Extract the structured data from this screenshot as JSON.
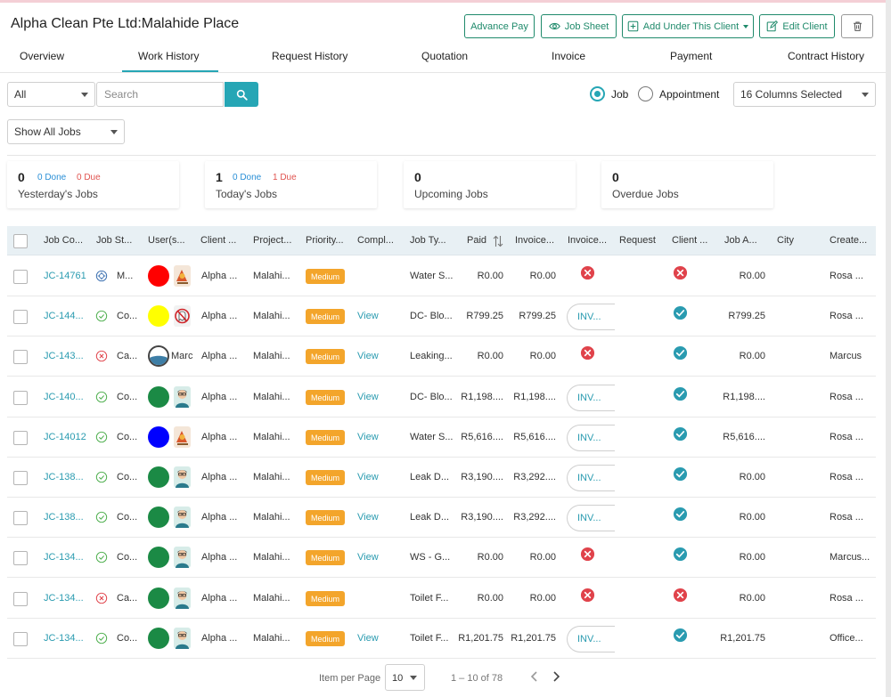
{
  "header": {
    "title": "Alpha Clean Pte Ltd:Malahide Place",
    "buttons": {
      "advance_pay": "Advance Pay",
      "job_sheet": "Job Sheet",
      "add_under_client": "Add Under This Client",
      "edit_client": "Edit Client"
    }
  },
  "tabs": [
    "Overview",
    "Work History",
    "Request History",
    "Quotation",
    "Invoice",
    "Payment",
    "Contract History"
  ],
  "active_tab": "Work History",
  "filters": {
    "type_select": "All",
    "search_placeholder": "Search",
    "radio_job": "Job",
    "radio_appointment": "Appointment",
    "selected_radio": "Job",
    "columns_select": "16 Columns Selected",
    "show_jobs_select": "Show All Jobs"
  },
  "summary_cards": [
    {
      "count": "0",
      "done": "0 Done",
      "due": "0 Due",
      "label": "Yesterday's Jobs"
    },
    {
      "count": "1",
      "done": "0 Done",
      "due": "1 Due",
      "label": "Today's Jobs"
    },
    {
      "count": "0",
      "done": "",
      "due": "",
      "label": "Upcoming Jobs"
    },
    {
      "count": "0",
      "done": "",
      "due": "",
      "label": "Overdue Jobs"
    }
  ],
  "table": {
    "columns": [
      "Job Co...",
      "Job St...",
      "User(s...",
      "Client ...",
      "Project...",
      "Priority...",
      "Compl...",
      "Job Ty...",
      "Paid",
      "Invoice...",
      "Invoice...",
      "Request",
      "Client ...",
      "Job A...",
      "City",
      "Create..."
    ],
    "rows": [
      {
        "code": "JC-14761",
        "status": "M...",
        "status_icon": "gear-icon",
        "user": "",
        "avatar_color": "#ff0000",
        "avatar2": "illustration",
        "client": "Alpha ...",
        "project": "Malahi...",
        "priority": "Medium",
        "completion": "",
        "job_type": "Water S...",
        "paid": "R0.00",
        "invoiced": "R0.00",
        "invoice": "error",
        "client_status": "error",
        "job_amount": "R0.00",
        "created": "Rosa ..."
      },
      {
        "code": "JC-144...",
        "status": "Co...",
        "status_icon": "check-circle-icon",
        "user": "",
        "avatar_color": "#ffff00",
        "avatar2": "ghost",
        "client": "Alpha ...",
        "project": "Malahi...",
        "priority": "Medium",
        "completion": "View",
        "job_type": "DC- Blo...",
        "paid": "R799.25",
        "invoiced": "R799.25",
        "invoice": "INV...",
        "client_status": "ok",
        "job_amount": "R799.25",
        "created": "Rosa ..."
      },
      {
        "code": "JC-143...",
        "status": "Ca...",
        "status_icon": "x-circle-icon",
        "user": "Marc",
        "avatar_color": "#ffffff",
        "avatar2": "",
        "client": "Alpha ...",
        "project": "Malahi...",
        "priority": "Medium",
        "completion": "View",
        "job_type": "Leaking...",
        "paid": "R0.00",
        "invoiced": "R0.00",
        "invoice": "error",
        "client_status": "ok",
        "job_amount": "R0.00",
        "created": "Marcus"
      },
      {
        "code": "JC-140...",
        "status": "Co...",
        "status_icon": "check-circle-icon",
        "user": "",
        "avatar_color": "#1b8a45",
        "avatar2": "person",
        "client": "Alpha ...",
        "project": "Malahi...",
        "priority": "Medium",
        "completion": "View",
        "job_type": "DC- Blo...",
        "paid": "R1,198....",
        "invoiced": "R1,198....",
        "invoice": "INV...",
        "client_status": "ok",
        "job_amount": "R1,198....",
        "created": "Rosa ..."
      },
      {
        "code": "JC-14012",
        "status": "Co...",
        "status_icon": "check-circle-icon",
        "user": "",
        "avatar_color": "#0000ff",
        "avatar2": "illustration",
        "client": "Alpha ...",
        "project": "Malahi...",
        "priority": "Medium",
        "completion": "View",
        "job_type": "Water S...",
        "paid": "R5,616....",
        "invoiced": "R5,616....",
        "invoice": "INV...",
        "client_status": "ok",
        "job_amount": "R5,616....",
        "created": "Rosa ..."
      },
      {
        "code": "JC-138...",
        "status": "Co...",
        "status_icon": "check-circle-icon",
        "user": "",
        "avatar_color": "#1b8a45",
        "avatar2": "person",
        "client": "Alpha ...",
        "project": "Malahi...",
        "priority": "Medium",
        "completion": "View",
        "job_type": "Leak D...",
        "paid": "R3,190....",
        "invoiced": "R3,292....",
        "invoice": "INV...",
        "client_status": "ok",
        "job_amount": "R0.00",
        "created": "Rosa ..."
      },
      {
        "code": "JC-138...",
        "status": "Co...",
        "status_icon": "check-circle-icon",
        "user": "",
        "avatar_color": "#1b8a45",
        "avatar2": "person",
        "client": "Alpha ...",
        "project": "Malahi...",
        "priority": "Medium",
        "completion": "View",
        "job_type": "Leak D...",
        "paid": "R3,190....",
        "invoiced": "R3,292....",
        "invoice": "INV...",
        "client_status": "ok",
        "job_amount": "R0.00",
        "created": "Rosa ..."
      },
      {
        "code": "JC-134...",
        "status": "Co...",
        "status_icon": "check-circle-icon",
        "user": "",
        "avatar_color": "#1b8a45",
        "avatar2": "person",
        "client": "Alpha ...",
        "project": "Malahi...",
        "priority": "Medium",
        "completion": "View",
        "job_type": "WS - G...",
        "paid": "R0.00",
        "invoiced": "R0.00",
        "invoice": "error",
        "client_status": "ok",
        "job_amount": "R0.00",
        "created": "Marcus..."
      },
      {
        "code": "JC-134...",
        "status": "Ca...",
        "status_icon": "x-circle-icon",
        "user": "",
        "avatar_color": "#1b8a45",
        "avatar2": "person",
        "client": "Alpha ...",
        "project": "Malahi...",
        "priority": "Medium",
        "completion": "",
        "job_type": "Toilet F...",
        "paid": "R0.00",
        "invoiced": "R0.00",
        "invoice": "error",
        "client_status": "error",
        "job_amount": "R0.00",
        "created": "Rosa ..."
      },
      {
        "code": "JC-134...",
        "status": "Co...",
        "status_icon": "check-circle-icon",
        "user": "",
        "avatar_color": "#1b8a45",
        "avatar2": "person",
        "client": "Alpha ...",
        "project": "Malahi...",
        "priority": "Medium",
        "completion": "View",
        "job_type": "Toilet F...",
        "paid": "R1,201.75",
        "invoiced": "R1,201.75",
        "invoice": "INV...",
        "client_status": "ok",
        "job_amount": "R1,201.75",
        "created": "Office..."
      }
    ]
  },
  "pagination": {
    "label": "Item per Page",
    "per_page": "10",
    "range": "1 – 10 of 78"
  },
  "colors": {
    "accent": "#26a6b5",
    "green_button": "#1f8a6b",
    "priority": "#f3a52b",
    "error": "#e0434b",
    "ok": "#2a9bb0"
  }
}
